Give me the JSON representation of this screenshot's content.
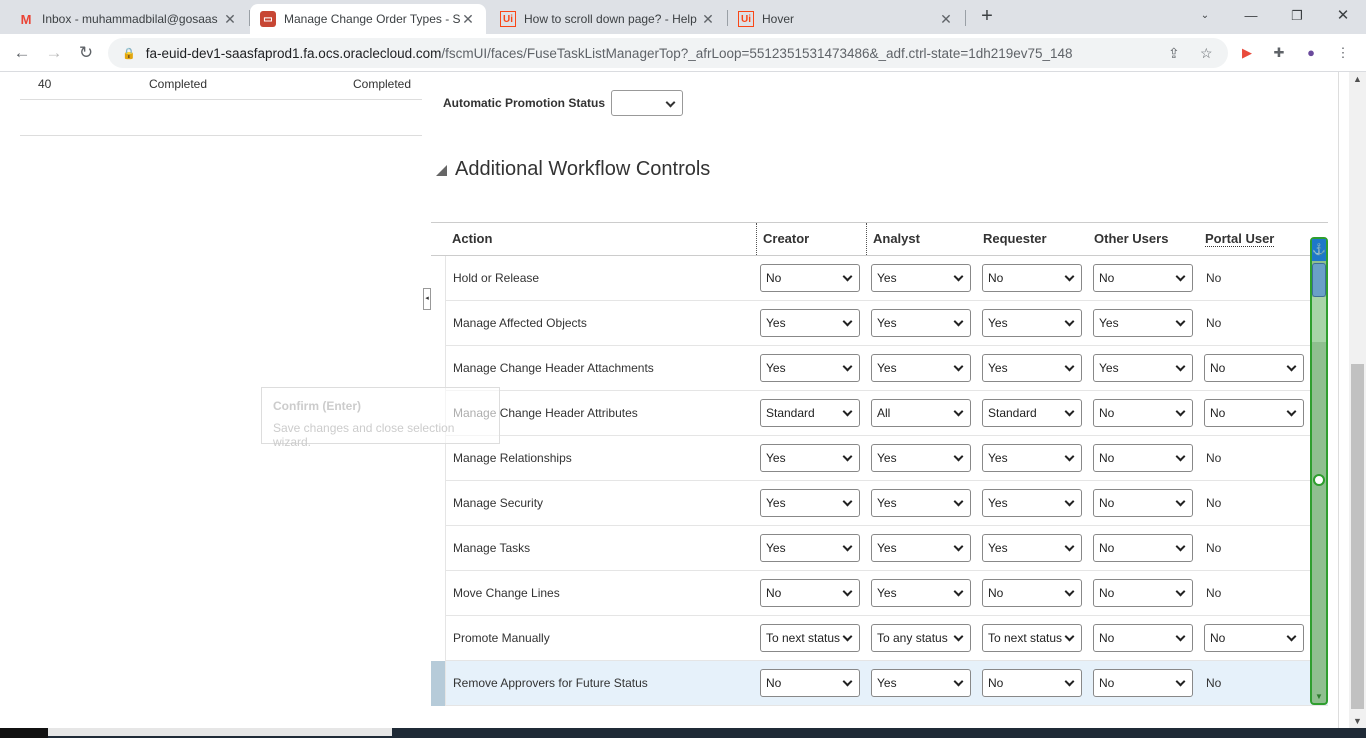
{
  "browser": {
    "tabs": [
      {
        "title": "Inbox - muhammadbilal@gosaas",
        "favicon": "gmail-icon",
        "active": false
      },
      {
        "title": "Manage Change Order Types - S",
        "favicon": "oracle-icon",
        "active": true
      },
      {
        "title": "How to scroll down page? - Help",
        "favicon": "uipath-icon",
        "active": false
      },
      {
        "title": "Hover",
        "favicon": "uipath-icon",
        "active": false
      }
    ],
    "url_host": "fa-euid-dev1-saasfaprod1.fa.ocs.oraclecloud.com",
    "url_path": "/fscmUI/faces/FuseTaskListManagerTop?_afrLoop=5512351531473486&_adf.ctrl-state=1dh219ev75_148"
  },
  "left_panel": {
    "row": {
      "num": "40",
      "status1": "Completed",
      "status2": "Completed"
    }
  },
  "tooltip": {
    "title": "Confirm (Enter)",
    "text": "Save changes and close selection wizard."
  },
  "promotion": {
    "label": "Automatic Promotion Status",
    "value": ""
  },
  "section": {
    "title": "Additional Workflow Controls"
  },
  "table": {
    "headers": {
      "action": "Action",
      "creator": "Creator",
      "analyst": "Analyst",
      "requester": "Requester",
      "other": "Other Users",
      "portal": "Portal User"
    },
    "rows": [
      {
        "action": "Hold or Release",
        "creator": "No",
        "analyst": "Yes",
        "requester": "No",
        "other": "No",
        "portal": "No",
        "portal_dd": false
      },
      {
        "action": "Manage Affected Objects",
        "creator": "Yes",
        "analyst": "Yes",
        "requester": "Yes",
        "other": "Yes",
        "portal": "No",
        "portal_dd": false
      },
      {
        "action": "Manage Change Header Attachments",
        "creator": "Yes",
        "analyst": "Yes",
        "requester": "Yes",
        "other": "Yes",
        "portal": "No",
        "portal_dd": true
      },
      {
        "action": "Manage Change Header Attributes",
        "creator": "Standard",
        "analyst": "All",
        "requester": "Standard",
        "other": "No",
        "portal": "No",
        "portal_dd": true
      },
      {
        "action": "Manage Relationships",
        "creator": "Yes",
        "analyst": "Yes",
        "requester": "Yes",
        "other": "No",
        "portal": "No",
        "portal_dd": false
      },
      {
        "action": "Manage Security",
        "creator": "Yes",
        "analyst": "Yes",
        "requester": "Yes",
        "other": "No",
        "portal": "No",
        "portal_dd": false
      },
      {
        "action": "Manage Tasks",
        "creator": "Yes",
        "analyst": "Yes",
        "requester": "Yes",
        "other": "No",
        "portal": "No",
        "portal_dd": false
      },
      {
        "action": "Move Change Lines",
        "creator": "No",
        "analyst": "Yes",
        "requester": "No",
        "other": "No",
        "portal": "No",
        "portal_dd": false
      },
      {
        "action": "Promote Manually",
        "creator": "To next status",
        "analyst": "To any status",
        "requester": "To next status",
        "other": "No",
        "portal": "No",
        "portal_dd": true
      },
      {
        "action": "Remove Approvers for Future Status",
        "creator": "No",
        "analyst": "Yes",
        "requester": "No",
        "other": "No",
        "portal": "No",
        "portal_dd": false,
        "selected": true
      }
    ]
  },
  "colors": {
    "selected_row": "#e6f1fa",
    "scroll_widget": "#2e9e2e"
  }
}
